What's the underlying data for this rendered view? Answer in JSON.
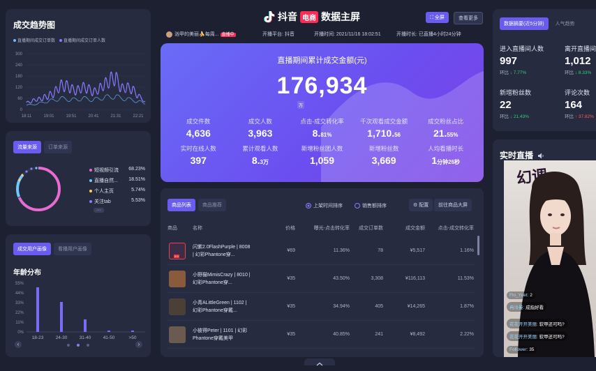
{
  "header": {
    "logo_text": "抖音",
    "logo_badge": "电商",
    "subtitle": "数据主屏",
    "fullscreen": "全屏",
    "more": "查看更多",
    "anchor": "汹甲的美丽🍌每周...",
    "live_badge": "直播中",
    "platform": "开播平台: 抖音",
    "start_time": "开播时间: 2021/11/16 18:02:51",
    "duration": "开播时长: 已直播4小时24分钟"
  },
  "hero": {
    "title": "直播期间累计成交金额(元)",
    "value": "176,934",
    "unit": "万",
    "kpis": [
      {
        "label": "成交件数",
        "value": "4,636",
        "suffix": ""
      },
      {
        "label": "成交人数",
        "value": "3,963",
        "suffix": ""
      },
      {
        "label": "点击-成交转化率",
        "value": "8.",
        "suffix": "81%"
      },
      {
        "label": "千次观看成交金额",
        "value": "1,710.",
        "suffix": "56"
      },
      {
        "label": "成交粉丝占比",
        "value": "21.",
        "suffix": "55%"
      },
      {
        "label": "实时在线人数",
        "value": "397",
        "suffix": ""
      },
      {
        "label": "累计观看人数",
        "value": "8.",
        "suffix": "3万"
      },
      {
        "label": "新增粉丝团人数",
        "value": "1,059",
        "suffix": ""
      },
      {
        "label": "新增粉丝数",
        "value": "3,669",
        "suffix": ""
      },
      {
        "label": "人均看播时长",
        "value": "1",
        "suffix": "分钟26秒"
      }
    ]
  },
  "products": {
    "tabs": [
      "商品列表",
      "商品推荐"
    ],
    "sort_options": [
      "上架时间排序",
      "销售额排序"
    ],
    "config": "配置",
    "goto": "前往商品大屏",
    "headers": [
      "商品",
      "名称",
      "价格",
      "曝光-点击转化率",
      "成交订单数",
      "成交金额",
      "点击-成交转化率"
    ],
    "rows": [
      {
        "name": "闪紫2.0FlashPurple | 8008 | 幻彩Phantone穿...",
        "price": "¥69",
        "expo": "11.36%",
        "orders": "78",
        "amount": "¥5,517",
        "ctr": "1.16%",
        "img_color": "#3a2d4a",
        "badge": "2.0"
      },
      {
        "name": "小野猫MimisCrazy | 8010 | 幻彩Phantone穿...",
        "price": "¥35",
        "expo": "43.50%",
        "orders": "3,308",
        "amount": "¥116,113",
        "ctr": "11.53%",
        "img_color": "#8a5a3c",
        "badge": ""
      },
      {
        "name": "小青ALittleGreen | 1102 | 幻彩Phantone穿戴...",
        "price": "¥35",
        "expo": "34.94%",
        "orders": "405",
        "amount": "¥14,265",
        "ctr": "1.87%",
        "img_color": "#4a4038",
        "badge": ""
      },
      {
        "name": "小彼得Peter | 1101 | 幻彩Phantone穿戴美甲",
        "price": "¥35",
        "expo": "40.85%",
        "orders": "241",
        "amount": "¥8,492",
        "ctr": "2.22%",
        "img_color": "#6b5a50",
        "badge": ""
      }
    ]
  },
  "trend": {
    "title": "成交趋势图",
    "legend": [
      "直播期间成交订单数",
      "直播期间成交订单人数"
    ],
    "y_ticks": [
      "300",
      "240",
      "180",
      "120",
      "60",
      "0"
    ],
    "x_ticks": [
      "18:11",
      "19:01",
      "19:51",
      "20:41",
      "21:31",
      "22:21"
    ],
    "colors": {
      "orders": "#6fb7ff",
      "users": "#8b7cff"
    }
  },
  "traffic": {
    "tabs": [
      "流量来源",
      "订单来源"
    ],
    "items": [
      {
        "label": "短视频引流",
        "value": "68.23%",
        "color": "#e86bd0"
      },
      {
        "label": "直播自然...",
        "value": "18.51%",
        "color": "#6fc7ff"
      },
      {
        "label": "个人主页",
        "value": "5.74%",
        "color": "#ffcf5c"
      },
      {
        "label": "关注tab",
        "value": "5.53%",
        "color": "#8b7cff"
      }
    ],
    "more": "···"
  },
  "age": {
    "tabs": [
      "成交用户画像",
      "看播用户画像"
    ],
    "title": "年龄分布",
    "y_ticks": [
      "55%",
      "44%",
      "33%",
      "22%",
      "11%",
      "0%"
    ],
    "x_ticks": [
      "18-23",
      "24-30",
      "31-40",
      "41-50",
      ">50"
    ],
    "prev": "‹",
    "next": "›"
  },
  "stats": {
    "tabs": [
      "数据摘要(近5分钟)",
      "人气趋势"
    ],
    "items": [
      {
        "label": "进入直播间人数",
        "value": "997",
        "ratio_label": "环比",
        "ratio": "↓ 7.77%",
        "dir": "up"
      },
      {
        "label": "离开直播间人数",
        "value": "1,012",
        "ratio_label": "环比",
        "ratio": "↓ 8.33%",
        "dir": "up"
      },
      {
        "label": "新增粉丝数",
        "value": "22",
        "ratio_label": "环比",
        "ratio": "↓ 21.43%",
        "dir": "up"
      },
      {
        "label": "评论次数",
        "value": "164",
        "ratio_label": "环比",
        "ratio": "↑ 37.82%",
        "dir": "down"
      }
    ]
  },
  "live": {
    "title": "实时直播",
    "brand": "幻调",
    "chats": [
      {
        "user": "Flo_Yuet:",
        "text": "2"
      },
      {
        "user": "冉冷曼:",
        "text": "成指好看"
      },
      {
        "user": "花花开开美丽:",
        "text": "软甲还可吗?"
      },
      {
        "user": "花花开开美丽:",
        "text": "软甲还可吗?"
      },
      {
        "user": "Follower:",
        "text": "35"
      }
    ]
  }
}
